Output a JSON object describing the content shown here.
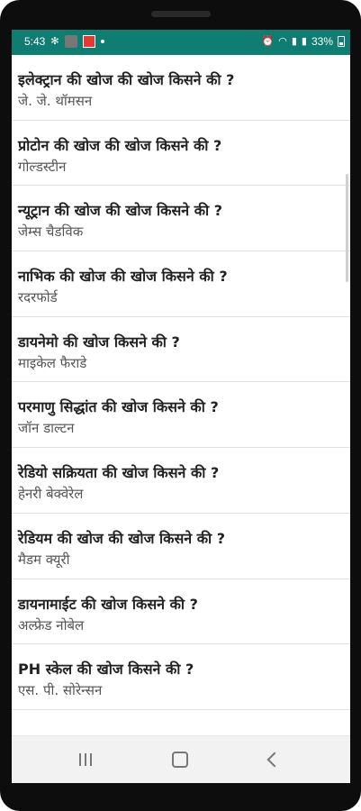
{
  "status_bar": {
    "time": "5:43",
    "battery": "33%",
    "bg_color": "#0f7d72"
  },
  "items": [
    {
      "question": "इलेक्ट्रान की खोज की खोज किसने की ?",
      "answer": "जे. जे. थॉमसन"
    },
    {
      "question": "प्रोटोन की खोज की खोज किसने की ?",
      "answer": "गोल्डस्टीन"
    },
    {
      "question": "न्यूट्रान की खोज की खोज किसने की ?",
      "answer": "जेम्स चैडविक"
    },
    {
      "question": "नाभिक की खोज की खोज किसने की ?",
      "answer": "रदरफोर्ड"
    },
    {
      "question": "डायनेमो की खोज किसने की ?",
      "answer": "माइकेल फैराडे"
    },
    {
      "question": "परमाणु सिद्धांत की खोज किसने की ?",
      "answer": "जॉन डाल्टन"
    },
    {
      "question": "रेडियो सक्रियता की खोज किसने की ?",
      "answer": "हेनरी बेक्वेरेल"
    },
    {
      "question": "रेडियम की खोज की खोज किसने की ?",
      "answer": "मैडम क्यूरी"
    },
    {
      "question": "डायनामाईट की खोज किसने की ?",
      "answer": "अल्फ्रेड नोबेल"
    },
    {
      "question": "PH स्केल की खोज किसने की ?",
      "answer": "एस. पी. सोरेन्सन"
    }
  ]
}
